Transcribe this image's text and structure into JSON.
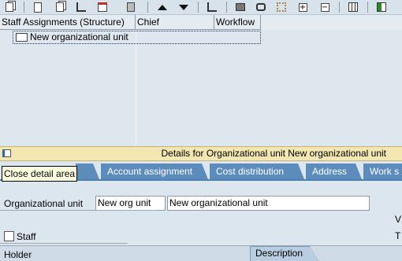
{
  "toolbar": {
    "buttons": [
      "assign-icon",
      "create-icon",
      "copy-icon",
      "structure-icon",
      "calendar-icon",
      "delete-icon",
      "up-icon",
      "down-icon",
      "hierarchy-icon",
      "print-icon",
      "find-icon",
      "find-next-icon",
      "expand-icon",
      "collapse-icon",
      "layout-icon",
      "columns-icon"
    ]
  },
  "tree": {
    "columns": [
      "Staff Assignments (Structure)",
      "Chief",
      "Workflow"
    ],
    "rows": [
      {
        "label": "New organizational unit"
      }
    ]
  },
  "detail": {
    "title": "Details for Organizational unit New organizational unit",
    "tooltip": "Close detail area",
    "tabs": [
      "Account assignment",
      "Cost distribution",
      "Address",
      "Work s"
    ]
  },
  "form": {
    "org_unit_label": "Organizational unit",
    "org_unit_short": "New org unit",
    "org_unit_long": "New organizational unit",
    "staff_label": "Staff",
    "staff_checked": false,
    "right_letter_1": "V",
    "right_letter_2": "T",
    "holder_label": "Holder",
    "description_tab": "Description"
  },
  "colors": {
    "tab_bg": "#5c8cbc",
    "detail_bar_bg": "#f2e6b2",
    "tooltip_bg": "#ffffe1"
  }
}
